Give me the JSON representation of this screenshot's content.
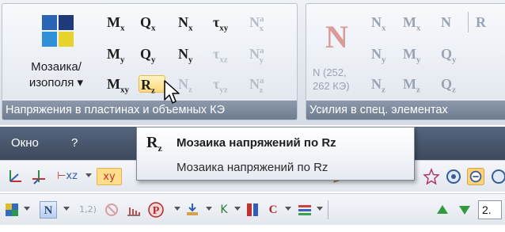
{
  "ribbon": {
    "mosaic_label_line1": "Мозаика/",
    "mosaic_label_line2": "изополя ▾",
    "plates_group_caption": "Напряжения в пластинах и объемных КЭ",
    "special_group_caption": "Усилия в спец. элементах",
    "plates_commands": {
      "mx": {
        "base": "M",
        "sub": "x"
      },
      "qx": {
        "base": "Q",
        "sub": "x"
      },
      "nx": {
        "base": "N",
        "sub": "x"
      },
      "txy": {
        "base": "τ",
        "sub": "xy"
      },
      "nax": {
        "base": "N",
        "sup": "a",
        "sub": "x"
      },
      "my": {
        "base": "M",
        "sub": "y"
      },
      "qy": {
        "base": "Q",
        "sub": "y"
      },
      "ny": {
        "base": "N",
        "sub": "y"
      },
      "txz": {
        "base": "τ",
        "sub": "xz"
      },
      "nay": {
        "base": "N",
        "sup": "a",
        "sub": "y"
      },
      "mxy": {
        "base": "M",
        "sub": "xy"
      },
      "rz": {
        "base": "R",
        "sub": "z"
      },
      "nz": {
        "base": "N",
        "sub": "z"
      },
      "tyz": {
        "base": "τ",
        "sub": "yz"
      },
      "naz": {
        "base": "N",
        "sup": "a",
        "sub": "z"
      }
    },
    "special_commands": {
      "big_n": "N",
      "big_n_label_line1": "N (252,",
      "big_n_label_line2": "262 КЭ)",
      "nx": {
        "base": "N",
        "sub": "x"
      },
      "mx": {
        "base": "M",
        "sub": "x"
      },
      "n": "N",
      "r": "R",
      "ny": {
        "base": "N",
        "sub": "y"
      },
      "my": {
        "base": "M",
        "sub": "y"
      },
      "qy": {
        "base": "Q",
        "sub": "y"
      },
      "nz": {
        "base": "N",
        "sub": "z"
      },
      "mz": {
        "base": "M",
        "sub": "z"
      },
      "qz": {
        "base": "Q",
        "sub": "z"
      }
    }
  },
  "menubar": {
    "items": [
      "Окно",
      "?"
    ]
  },
  "tooltip": {
    "icon": {
      "base": "R",
      "sub": "z"
    },
    "title": "Мозаика напряжений по Rz",
    "description": "Мозаика напряжений по Rz"
  },
  "toolbar1": {
    "xz_label": "xz",
    "xy_label": "xy"
  },
  "toolbar2": {
    "n_label": "N",
    "step_label": "1,2)",
    "k_label": "K",
    "c_label": "C",
    "value_field": "2."
  },
  "colors": {
    "accent_highlight": "#ffd97a",
    "menubar": "#4a586d",
    "group_caption": "#7f8b9e"
  }
}
